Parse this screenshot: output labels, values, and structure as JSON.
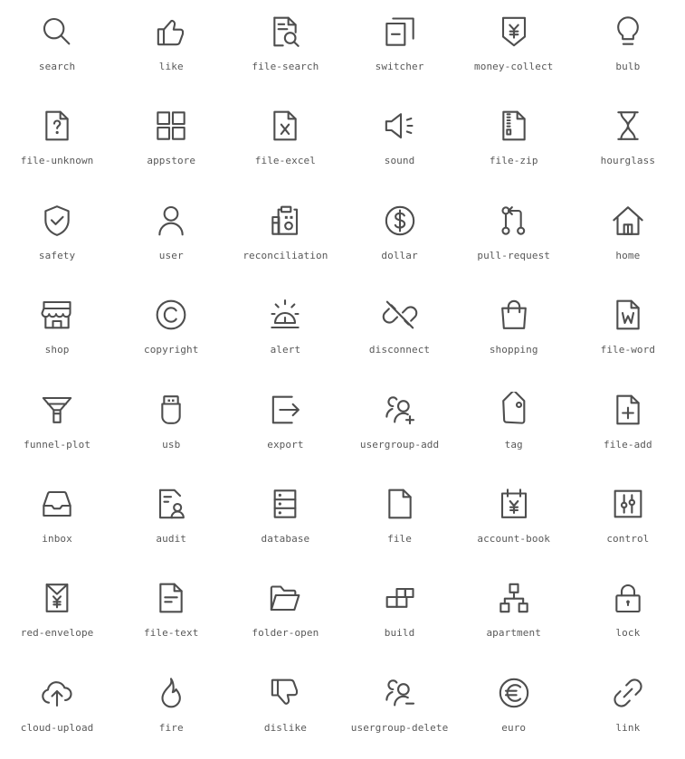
{
  "gallery": {
    "columns": 6,
    "rows": 8,
    "background_color": "#ffffff",
    "icon_stroke_color": "#4e4e4e",
    "label_color": "#595959",
    "icons": [
      {
        "name": "search",
        "label": "search",
        "glyph": "search"
      },
      {
        "name": "like",
        "label": "like",
        "glyph": "like"
      },
      {
        "name": "file-search",
        "label": "file-search",
        "glyph": "file-search"
      },
      {
        "name": "switcher",
        "label": "switcher",
        "glyph": "switcher"
      },
      {
        "name": "money-collect",
        "label": "money-collect",
        "glyph": "money-collect"
      },
      {
        "name": "bulb",
        "label": "bulb",
        "glyph": "bulb"
      },
      {
        "name": "file-unknown",
        "label": "file-unknown",
        "glyph": "file-unknown"
      },
      {
        "name": "appstore",
        "label": "appstore",
        "glyph": "appstore"
      },
      {
        "name": "file-excel",
        "label": "file-excel",
        "glyph": "file-excel"
      },
      {
        "name": "sound",
        "label": "sound",
        "glyph": "sound"
      },
      {
        "name": "file-zip",
        "label": "file-zip",
        "glyph": "file-zip"
      },
      {
        "name": "hourglass",
        "label": "hourglass",
        "glyph": "hourglass"
      },
      {
        "name": "safety",
        "label": "safety",
        "glyph": "safety"
      },
      {
        "name": "user",
        "label": "user",
        "glyph": "user"
      },
      {
        "name": "reconciliation",
        "label": "reconciliation",
        "glyph": "reconciliation"
      },
      {
        "name": "dollar",
        "label": "dollar",
        "glyph": "dollar"
      },
      {
        "name": "pull-request",
        "label": "pull-request",
        "glyph": "pull-request"
      },
      {
        "name": "home",
        "label": "home",
        "glyph": "home"
      },
      {
        "name": "shop",
        "label": "shop",
        "glyph": "shop"
      },
      {
        "name": "copyright",
        "label": "copyright",
        "glyph": "copyright"
      },
      {
        "name": "alert",
        "label": "alert",
        "glyph": "alert"
      },
      {
        "name": "disconnect",
        "label": "disconnect",
        "glyph": "disconnect"
      },
      {
        "name": "shopping",
        "label": "shopping",
        "glyph": "shopping"
      },
      {
        "name": "file-word",
        "label": "file-word",
        "glyph": "file-word"
      },
      {
        "name": "funnel-plot",
        "label": "funnel-plot",
        "glyph": "funnel-plot"
      },
      {
        "name": "usb",
        "label": "usb",
        "glyph": "usb"
      },
      {
        "name": "export",
        "label": "export",
        "glyph": "export"
      },
      {
        "name": "usergroup-add",
        "label": "usergroup-add",
        "glyph": "usergroup-add"
      },
      {
        "name": "tag",
        "label": "tag",
        "glyph": "tag"
      },
      {
        "name": "file-add",
        "label": "file-add",
        "glyph": "file-add"
      },
      {
        "name": "inbox",
        "label": "inbox",
        "glyph": "inbox"
      },
      {
        "name": "audit",
        "label": "audit",
        "glyph": "audit"
      },
      {
        "name": "database",
        "label": "database",
        "glyph": "database"
      },
      {
        "name": "file",
        "label": "file",
        "glyph": "file"
      },
      {
        "name": "account-book",
        "label": "account-book",
        "glyph": "account-book"
      },
      {
        "name": "control",
        "label": "control",
        "glyph": "control"
      },
      {
        "name": "red-envelope",
        "label": "red-envelope",
        "glyph": "red-envelope"
      },
      {
        "name": "file-text",
        "label": "file-text",
        "glyph": "file-text"
      },
      {
        "name": "folder-open",
        "label": "folder-open",
        "glyph": "folder-open"
      },
      {
        "name": "build",
        "label": "build",
        "glyph": "build"
      },
      {
        "name": "apartment",
        "label": "apartment",
        "glyph": "apartment"
      },
      {
        "name": "lock",
        "label": "lock",
        "glyph": "lock"
      },
      {
        "name": "cloud-upload",
        "label": "cloud-upload",
        "glyph": "cloud-upload"
      },
      {
        "name": "fire",
        "label": "fire",
        "glyph": "fire"
      },
      {
        "name": "dislike",
        "label": "dislike",
        "glyph": "dislike"
      },
      {
        "name": "usergroup-delete",
        "label": "usergroup-delete",
        "glyph": "usergroup-delete"
      },
      {
        "name": "euro",
        "label": "euro",
        "glyph": "euro"
      },
      {
        "name": "link",
        "label": "link",
        "glyph": "link"
      }
    ]
  }
}
